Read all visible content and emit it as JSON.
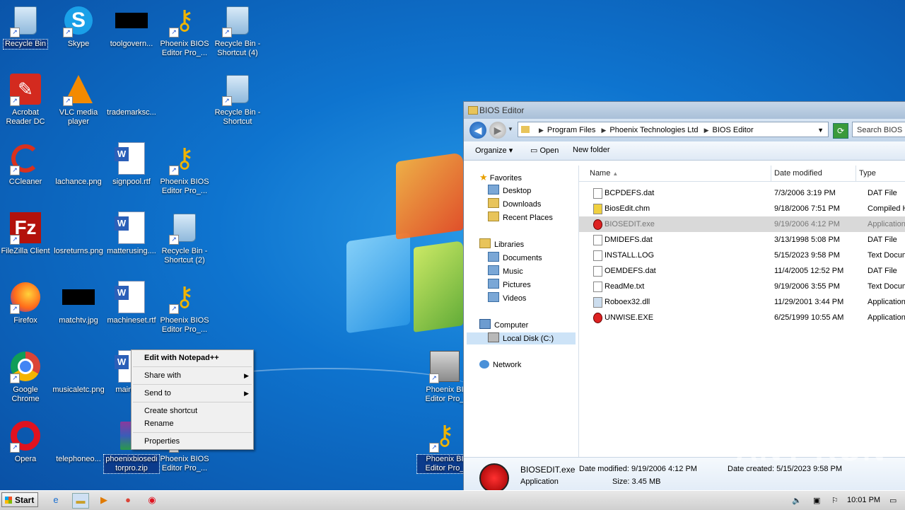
{
  "desktop_icons": [
    {
      "label": "Recycle Bin",
      "icon": "recycle-bin-icon",
      "selected": true
    },
    {
      "label": "Skype",
      "icon": "skype-icon"
    },
    {
      "label": "toolgovern...",
      "icon": "image-file-icon"
    },
    {
      "label": "Phoenix BIOS Editor Pro_...",
      "icon": "key-icon"
    },
    {
      "label": "Recycle Bin - Shortcut (4)",
      "icon": "recycle-bin-icon"
    },
    {
      "label": "Acrobat Reader DC",
      "icon": "acrobat-icon"
    },
    {
      "label": "VLC media player",
      "icon": "vlc-icon"
    },
    {
      "label": "trademarksc...",
      "icon": "image-file-icon"
    },
    {
      "label": "Recycle Bin - Shortcut",
      "icon": "recycle-bin-icon"
    },
    {
      "label": "CCleaner",
      "icon": "ccleaner-icon"
    },
    {
      "label": "lachance.png",
      "icon": "image-file-icon"
    },
    {
      "label": "signpool.rtf",
      "icon": "word-doc-icon"
    },
    {
      "label": "Phoenix BIOS Editor Pro_...",
      "icon": "key-icon"
    },
    {
      "label": "FileZilla Client",
      "icon": "filezilla-icon"
    },
    {
      "label": "losreturns.png",
      "icon": "image-file-icon"
    },
    {
      "label": "matterusing....",
      "icon": "word-doc-icon"
    },
    {
      "label": "Recycle Bin - Shortcut (2)",
      "icon": "recycle-bin-icon"
    },
    {
      "label": "Firefox",
      "icon": "firefox-icon"
    },
    {
      "label": "matchtv.jpg",
      "icon": "image-file-icon"
    },
    {
      "label": "machineset.rtf",
      "icon": "word-doc-icon"
    },
    {
      "label": "Phoenix BIOS Editor Pro_...",
      "icon": "key-icon"
    },
    {
      "label": "Google Chrome",
      "icon": "chrome-icon"
    },
    {
      "label": "musicaletc.png",
      "icon": "image-file-icon"
    },
    {
      "label": "mainde...",
      "icon": "word-doc-icon"
    },
    {
      "label": "Phoenix BI Editor Pro_",
      "icon": "setup-icon"
    },
    {
      "label": "Opera",
      "icon": "opera-icon"
    },
    {
      "label": "telephoneo...",
      "icon": "image-file-icon"
    },
    {
      "label": "phoenixbiosedi torpro.zip",
      "icon": "zip-icon",
      "selected": true
    },
    {
      "label": "Phoenix BIOS Editor Pro_...",
      "icon": "key-icon"
    },
    {
      "label": "Phoenix BI Editor Pro_",
      "icon": "key-icon",
      "selected": true
    }
  ],
  "context_menu": {
    "items": [
      "Edit with Notepad++",
      "Share with",
      "Send to",
      "Create shortcut",
      "Rename",
      "Properties"
    ]
  },
  "explorer": {
    "title": "BIOS Editor",
    "breadcrumb": [
      "Program Files",
      "Phoenix Technologies Ltd",
      "BIOS Editor"
    ],
    "search_placeholder": "Search BIOS E",
    "toolbar": {
      "organize": "Organize",
      "open": "Open",
      "new_folder": "New folder"
    },
    "nav": {
      "favorites": "Favorites",
      "desktop": "Desktop",
      "downloads": "Downloads",
      "recent": "Recent Places",
      "libraries": "Libraries",
      "documents": "Documents",
      "music": "Music",
      "pictures": "Pictures",
      "videos": "Videos",
      "computer": "Computer",
      "local_disk": "Local Disk (C:)",
      "network": "Network"
    },
    "columns": {
      "name": "Name",
      "date": "Date modified",
      "type": "Type"
    },
    "files": [
      {
        "name": "BCPDEFS.dat",
        "date": "7/3/2006 3:19 PM",
        "type": "DAT File"
      },
      {
        "name": "BiosEdit.chm",
        "date": "9/18/2006 7:51 PM",
        "type": "Compiled HTM"
      },
      {
        "name": "BIOSEDIT.exe",
        "date": "9/19/2006 4:12 PM",
        "type": "Application"
      },
      {
        "name": "DMIDEFS.dat",
        "date": "3/13/1998 5:08 PM",
        "type": "DAT File"
      },
      {
        "name": "INSTALL.LOG",
        "date": "5/15/2023 9:58 PM",
        "type": "Text Documen"
      },
      {
        "name": "OEMDEFS.dat",
        "date": "11/4/2005 12:52 PM",
        "type": "DAT File"
      },
      {
        "name": "ReadMe.txt",
        "date": "9/19/2006 3:55 PM",
        "type": "Text Documen"
      },
      {
        "name": "Roboex32.dll",
        "date": "11/29/2001 3:44 PM",
        "type": "Application ex"
      },
      {
        "name": "UNWISE.EXE",
        "date": "6/25/1999 10:55 AM",
        "type": "Application"
      }
    ],
    "details": {
      "name": "BIOSEDIT.exe",
      "modified": "Date modified: 9/19/2006 4:12 PM",
      "created": "Date created: 5/15/2023 9:58 PM",
      "kind": "Application",
      "size": "Size: 3.45 MB"
    }
  },
  "watermark": "ANY RUN",
  "taskbar": {
    "start": "Start",
    "clock": "10:01 PM"
  }
}
